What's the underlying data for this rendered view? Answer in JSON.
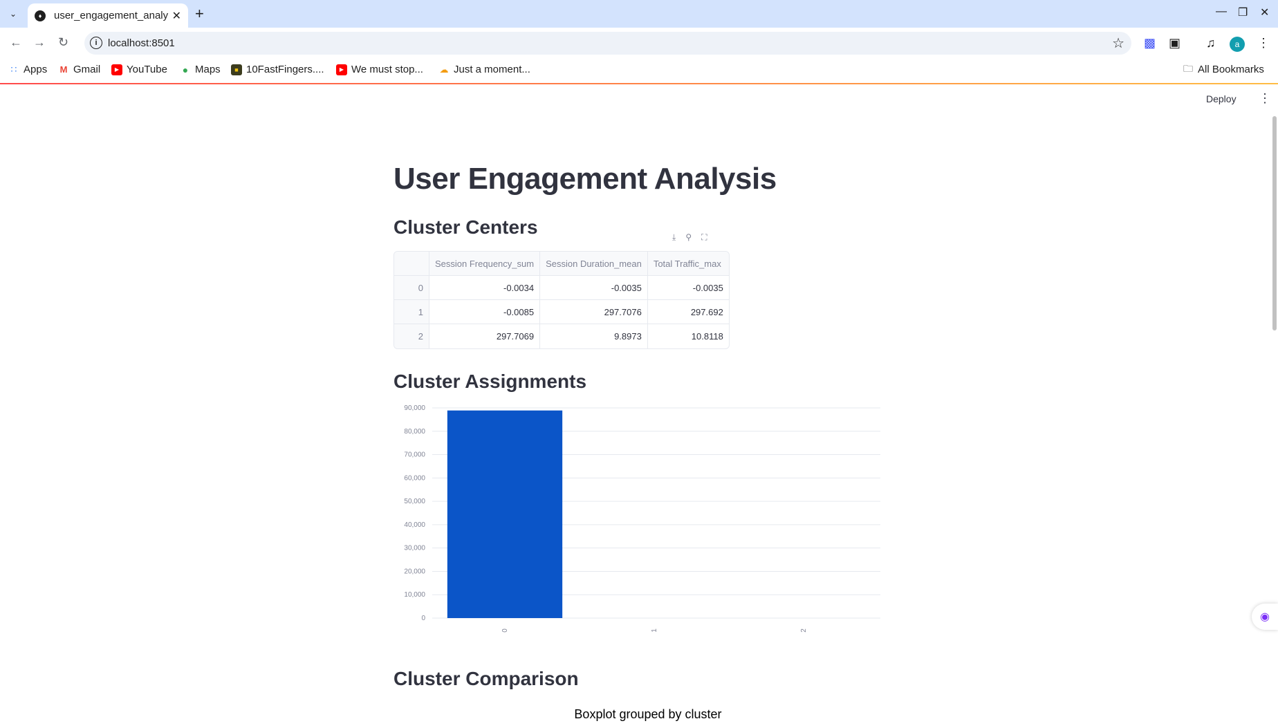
{
  "browser": {
    "tab_title": "user_engagement_analy",
    "url": "localhost:8501",
    "bookmarks": [
      "Apps",
      "Gmail",
      "YouTube",
      "Maps",
      "10FastFingers....",
      "We must stop...",
      "Just a moment..."
    ],
    "all_bookmarks": "All Bookmarks",
    "profile_initial": "a"
  },
  "header": {
    "deploy_label": "Deploy"
  },
  "page": {
    "title": "User Engagement Analysis",
    "section_centers": "Cluster Centers",
    "section_assignments": "Cluster Assignments",
    "section_comparison": "Cluster Comparison",
    "boxplot_title": "Boxplot grouped by cluster"
  },
  "table": {
    "columns": [
      "",
      "Session Frequency_sum",
      "Session Duration_mean",
      "Total Traffic_max"
    ],
    "rows": [
      [
        "0",
        "-0.0034",
        "-0.0035",
        "-0.0035"
      ],
      [
        "1",
        "-0.0085",
        "297.7076",
        "297.692"
      ],
      [
        "2",
        "297.7069",
        "9.8973",
        "10.8118"
      ]
    ]
  },
  "chart_data": {
    "type": "bar",
    "categories": [
      "0",
      "1",
      "2"
    ],
    "values": [
      88900,
      0,
      0
    ],
    "ylim": [
      0,
      90000
    ],
    "yticks": [
      "90,000",
      "80,000",
      "70,000",
      "60,000",
      "50,000",
      "40,000",
      "30,000",
      "20,000",
      "10,000",
      "0"
    ],
    "grid": true,
    "bar_color": "#0b55c8"
  },
  "colors": {
    "accent": "#ff4b4b",
    "text": "#31333f",
    "tabstrip": "#d3e3fd"
  }
}
